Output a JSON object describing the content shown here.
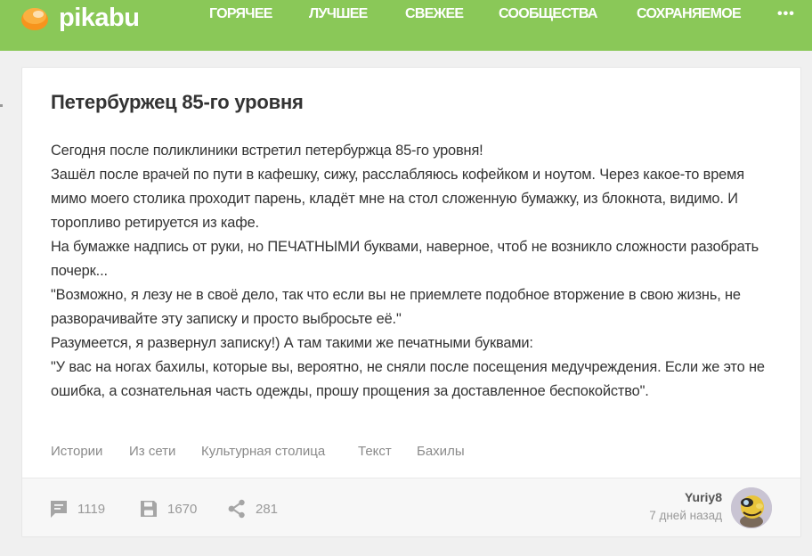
{
  "header": {
    "logo_text": "pikabu",
    "logo_color": "#f7941d",
    "accent": "#8ac858",
    "nav": [
      {
        "label": "ГОРЯЧЕЕ"
      },
      {
        "label": "ЛУЧШЕЕ"
      },
      {
        "label": "СВЕЖЕЕ"
      },
      {
        "label": "СООБЩЕСТВА"
      },
      {
        "label": "СОХРАНЯЕМОЕ"
      }
    ],
    "more_label": "•••"
  },
  "post": {
    "title": "Петербуржец 85-го уровня",
    "body": [
      "Сегодня после поликлиники встретил петербуржца 85-го уровня!",
      "Зашёл после врачей по пути в кафешку, сижу, расслабляюсь кофейком и ноутом. Через какое-то время мимо моего столика проходит парень, кладёт мне на стол сложенную бумажку, из блокнота, видимо. И торопливо ретируется из кафе.",
      "На бумажке надпись от руки, но ПЕЧАТНЫМИ буквами, наверное, чтоб не возникло сложности разобрать почерк...",
      "\"Возможно, я лезу не в своё дело, так что если вы не приемлете подобное вторжение в свою жизнь, не разворачивайте эту записку и просто выбросьте её.\"",
      "Разумеется, я развернул записку!) А там такими же печатными буквами:",
      "\"У вас на ногах бахилы, которые вы, вероятно, не сняли после посещения медучреждения. Если же это не ошибка, а сознательная часть одежды, прошу прощения за доставленное беспокойство\"."
    ],
    "tags": [
      "Истории",
      "Из сети",
      "Культурная столица",
      "Текст",
      "Бахилы"
    ]
  },
  "footer": {
    "comments": {
      "icon": "comment-icon",
      "count": "1119"
    },
    "saves": {
      "icon": "save-icon",
      "count": "1670"
    },
    "shares": {
      "icon": "share-icon",
      "count": "281"
    },
    "author": {
      "name": "Yuriy8",
      "time": "7 дней назад"
    }
  }
}
